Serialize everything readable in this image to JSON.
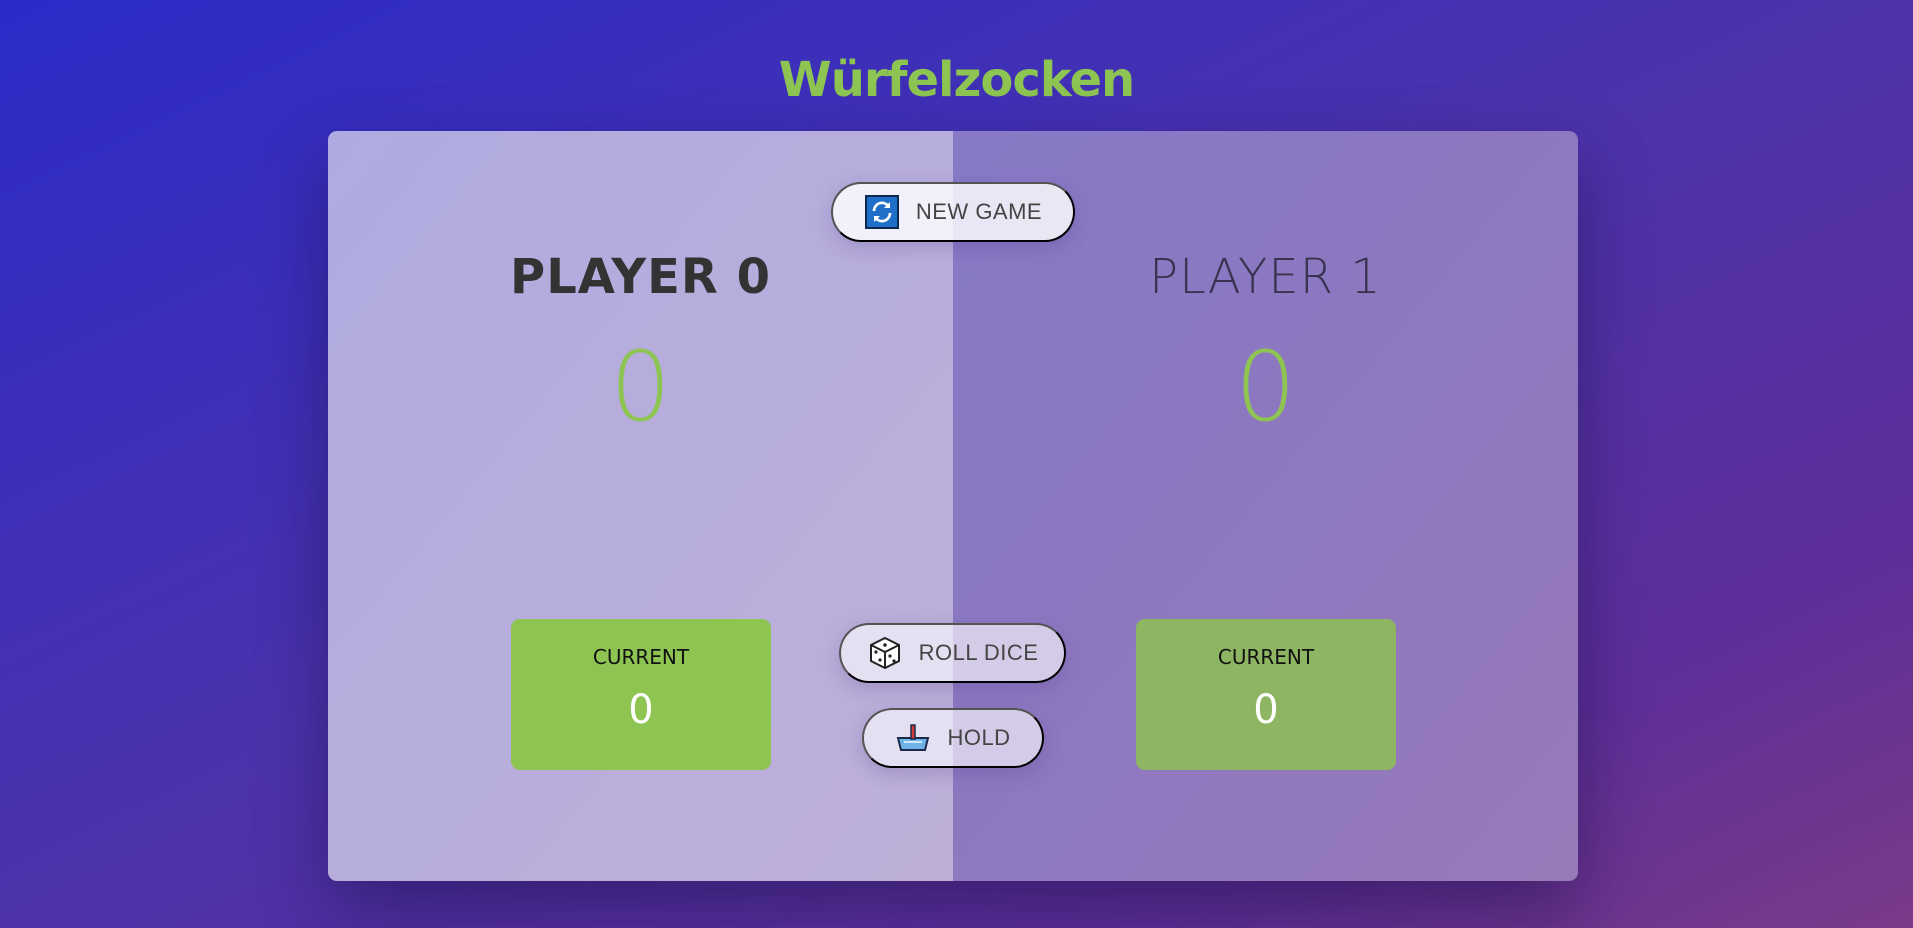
{
  "app": {
    "title": "Würfelzocken"
  },
  "players": [
    {
      "name": "PLAYER 0",
      "score": "0",
      "current_label": "CURRENT",
      "current_score": "0",
      "active": true
    },
    {
      "name": "PLAYER 1",
      "score": "0",
      "current_label": "CURRENT",
      "current_score": "0",
      "active": false
    }
  ],
  "controls": {
    "new_game": {
      "label": "NEW GAME",
      "icon": "refresh-icon"
    },
    "roll_dice": {
      "label": "ROLL DICE",
      "icon": "dice-icon"
    },
    "hold": {
      "label": "HOLD",
      "icon": "hold-icon"
    }
  },
  "colors": {
    "accent": "#8dc452",
    "active_current_bg": "#8dc452",
    "inactive_current_bg": "#8eb562",
    "text_dark": "#333333"
  }
}
